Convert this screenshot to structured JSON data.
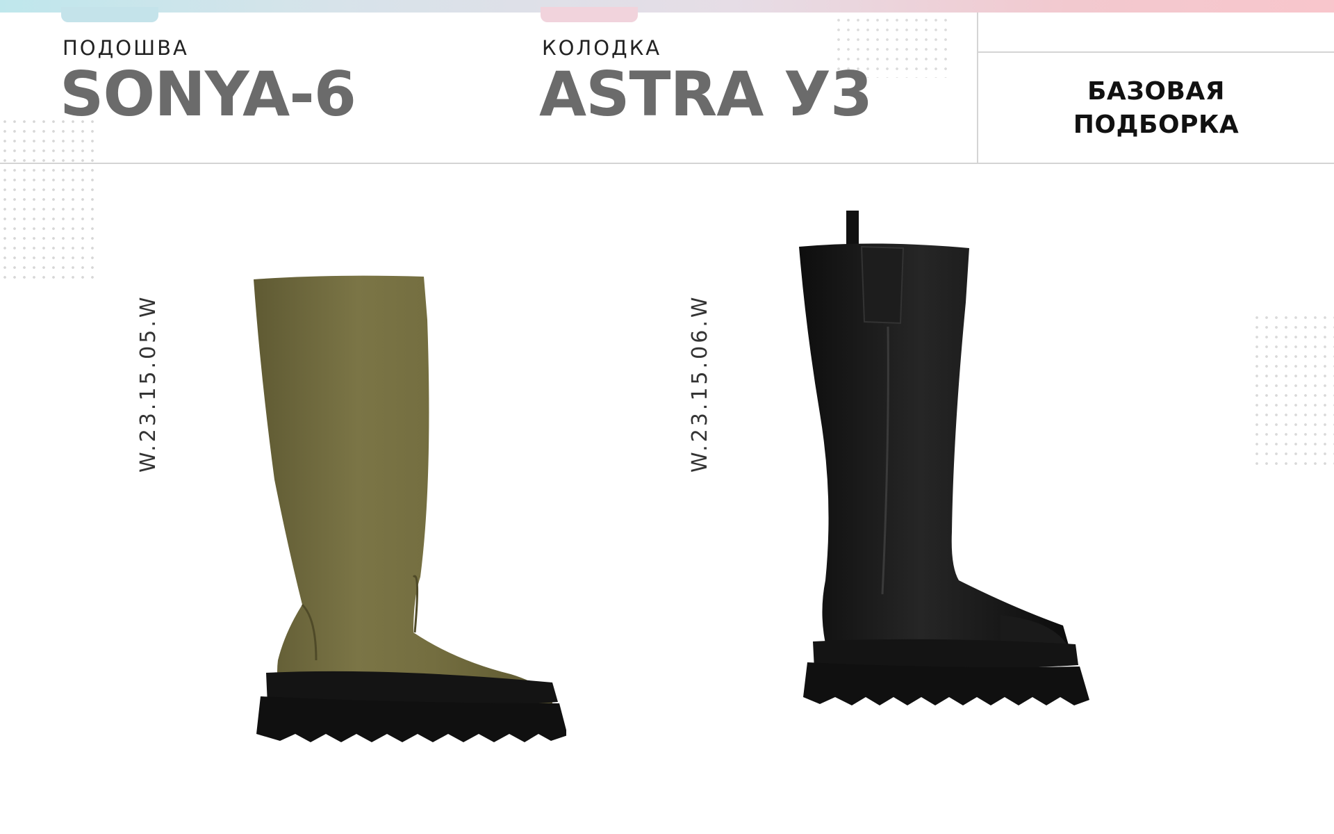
{
  "header": {
    "sole_caption": "ПОДОШВА",
    "sole_name": "SONYA-6",
    "last_caption": "КОЛОДКА",
    "last_name": "ASTRA У3",
    "collection_line1": "БАЗОВАЯ",
    "collection_line2": "ПОДБОРКА"
  },
  "products": [
    {
      "sku": "W.23.15.05.W",
      "color": "#736d3f",
      "image": "olive-knee-high-boot"
    },
    {
      "sku": "W.23.15.06.W",
      "color": "#1a1a1a",
      "image": "black-knee-high-boot"
    }
  ],
  "colors": {
    "title_gray": "#6b6b6b",
    "divider": "#d4d4d4",
    "sole_black": "#141414"
  }
}
